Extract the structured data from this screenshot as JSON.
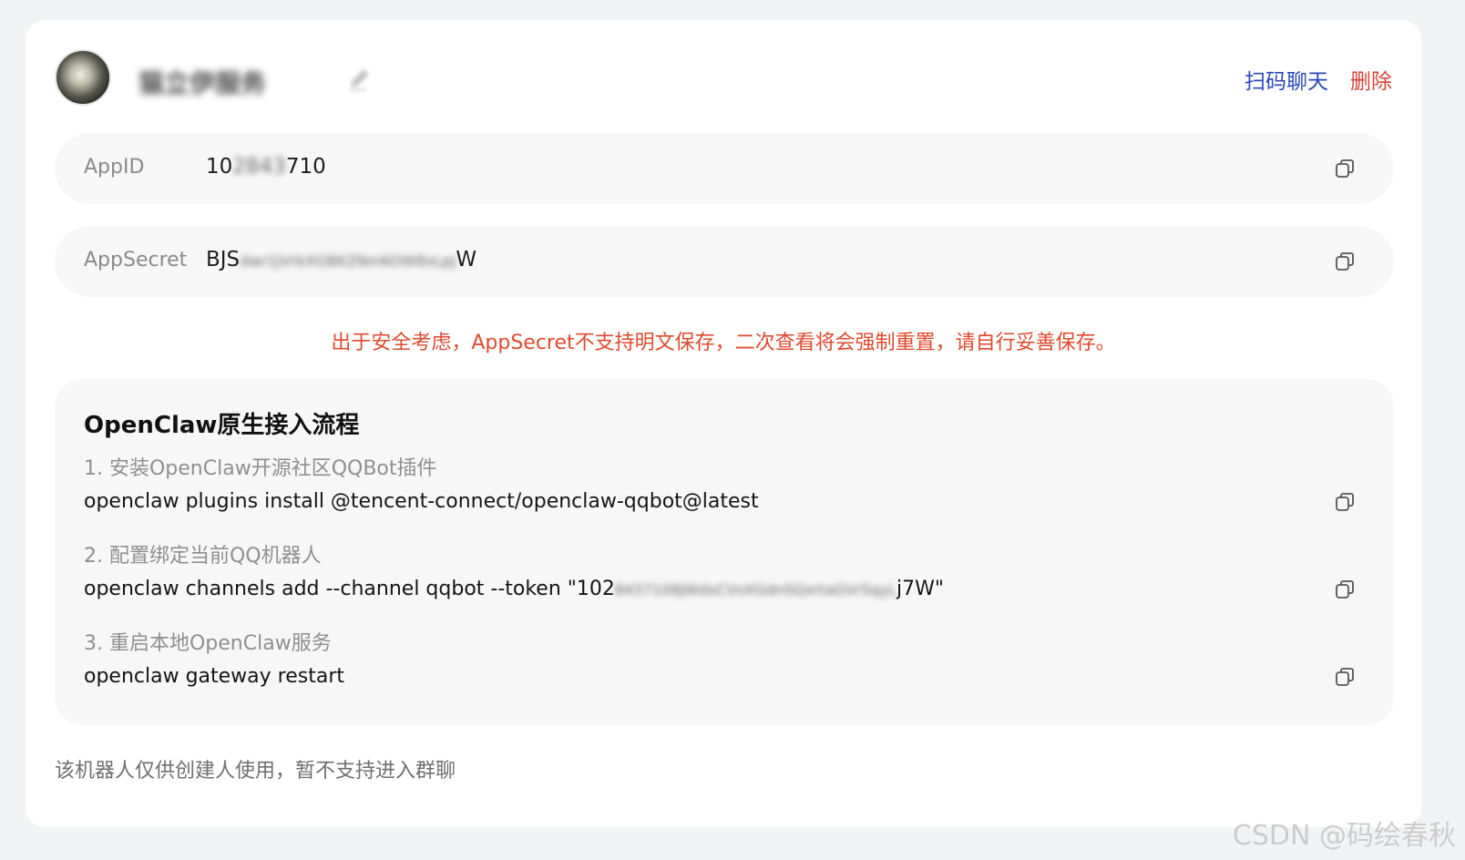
{
  "bot": {
    "name": "猫立伊服务",
    "edit_icon": "edit-icon"
  },
  "header": {
    "scan_chat": "扫码聊天",
    "delete": "删除"
  },
  "fields": {
    "appid": {
      "label": "AppID",
      "value_prefix": "10",
      "value_hidden": "2843",
      "value_suffix": "710"
    },
    "appsecret": {
      "label": "AppSecret",
      "value_prefix": "BJS",
      "value_hidden": "dwr1JVrbXGBKZNmKOW8xLpJ",
      "value_suffix": "W"
    }
  },
  "warning": "出于安全考虑，AppSecret不支持明文保存，二次查看将会强制重置，请自行妥善保存。",
  "flow": {
    "title": "OpenClaw原生接入流程",
    "steps": [
      {
        "label": "1. 安装OpenClaw开源社区QQBot插件",
        "cmd": "openclaw plugins install @tencent-connect/openclaw-qqbot@latest"
      },
      {
        "label": "2. 配置绑定当前QQ机器人",
        "cmd_prefix": "openclaw channels add --channel qqbot --token \"102",
        "cmd_hidden": "8437108JWdxCVsXGdnSQxrtaGVr5qyL",
        "cmd_suffix": "j7W\""
      },
      {
        "label": "3. 重启本地OpenClaw服务",
        "cmd": "openclaw gateway restart"
      }
    ]
  },
  "footer_note": "该机器人仅供创建人使用，暂不支持进入群聊",
  "watermark": "CSDN @码绘春秋",
  "icons": {
    "copy": "copy-icon"
  },
  "colors": {
    "link_blue": "#2a48b9",
    "danger_red": "#d2453a",
    "warning": "#e04a2f"
  }
}
